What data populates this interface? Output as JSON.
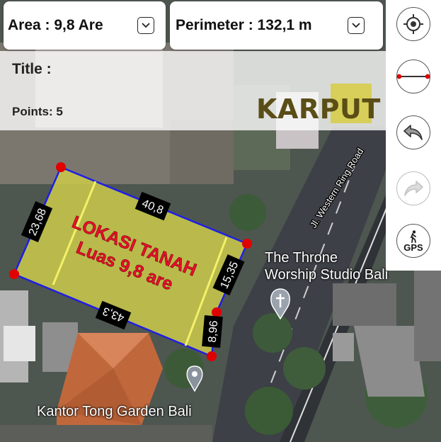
{
  "header": {
    "area": {
      "label": "Area : 9,8 Are"
    },
    "perimeter": {
      "label": "Perimeter : 132,1 m"
    }
  },
  "info": {
    "title_label": "Title :",
    "points_label": "Points: 5"
  },
  "logo_text": "KARPUT",
  "plot": {
    "line1": "LOKASI TANAH",
    "line2": "Luas 9,8 are",
    "edges": [
      "40,8",
      "15,35",
      "8,96",
      "43,3",
      "23,68"
    ],
    "polygon_color": "#1e1ee6",
    "fill_color": "#c8c84a",
    "vertex_color": "#e00000",
    "text_color": "#e8102a"
  },
  "map_labels": {
    "road": "Jl. Western Ring Road",
    "throne": "The Throne\nWorship Studio Bali",
    "throne_line1": "The Throne",
    "throne_line2": "Worship Studio Bali",
    "kantor": "Kantor Tong Garden Bali"
  },
  "tools": [
    {
      "name": "locate",
      "icon": "crosshair-icon"
    },
    {
      "name": "measure",
      "icon": "measure-line-icon"
    },
    {
      "name": "undo",
      "icon": "undo-icon"
    },
    {
      "name": "redo",
      "icon": "redo-icon",
      "disabled": true
    },
    {
      "name": "gps",
      "icon": "gps-walk-icon",
      "label": "GPS"
    }
  ]
}
